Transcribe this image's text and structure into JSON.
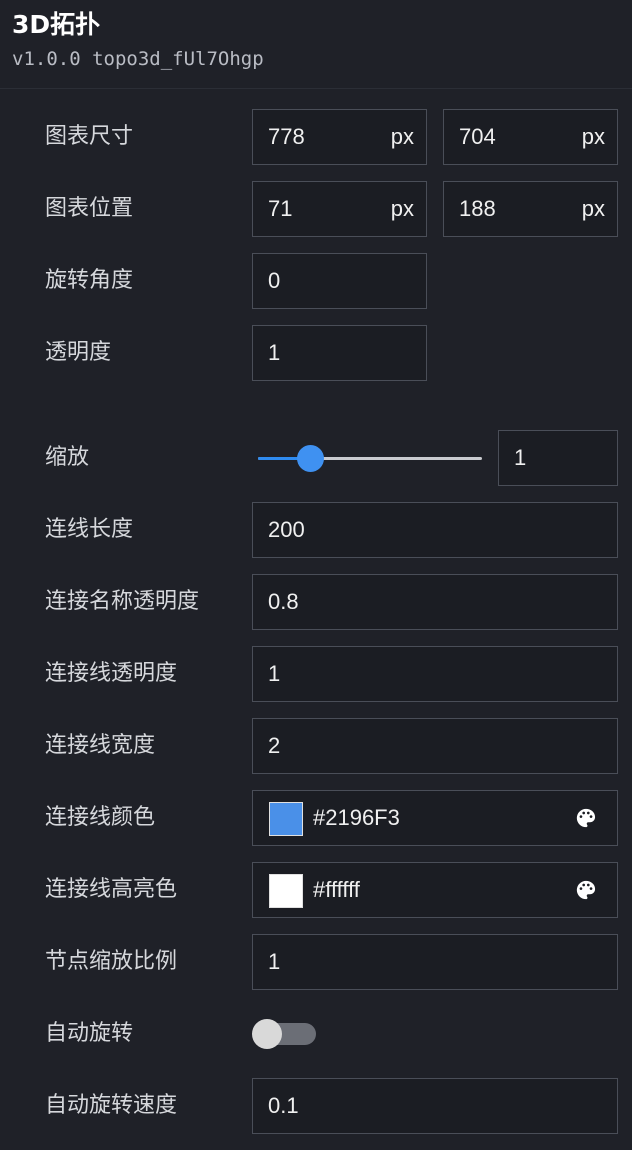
{
  "header": {
    "title": "3D拓扑",
    "version": "v1.0.0 topo3d_fUl7Ohgp"
  },
  "fields": {
    "size": {
      "label": "图表尺寸",
      "width": "778",
      "height": "704",
      "unit": "px"
    },
    "position": {
      "label": "图表位置",
      "x": "71",
      "y": "188",
      "unit": "px"
    },
    "rotation": {
      "label": "旋转角度",
      "value": "0"
    },
    "opacity": {
      "label": "透明度",
      "value": "1"
    },
    "zoom": {
      "label": "缩放",
      "value": "1",
      "slider_fraction": 0.23
    },
    "link_length": {
      "label": "连线长度",
      "value": "200"
    },
    "link_name_opacity": {
      "label": "连接名称透明度",
      "value": "0.8"
    },
    "link_opacity": {
      "label": "连接线透明度",
      "value": "1"
    },
    "link_width": {
      "label": "连接线宽度",
      "value": "2"
    },
    "link_color": {
      "label": "连接线颜色",
      "value": "#2196F3",
      "swatch": "#4a90e8",
      "icon": "palette-icon"
    },
    "link_highlight": {
      "label": "连接线高亮色",
      "value": "#ffffff",
      "swatch": "#ffffff",
      "icon": "palette-icon"
    },
    "node_scale": {
      "label": "节点缩放比例",
      "value": "1"
    },
    "auto_rotate": {
      "label": "自动旋转",
      "enabled": false
    },
    "auto_rotate_speed": {
      "label": "自动旋转速度",
      "value": "0.1"
    }
  },
  "colors": {
    "accent": "#3f91f1",
    "background": "#1f2128",
    "border": "#4a4e58"
  }
}
